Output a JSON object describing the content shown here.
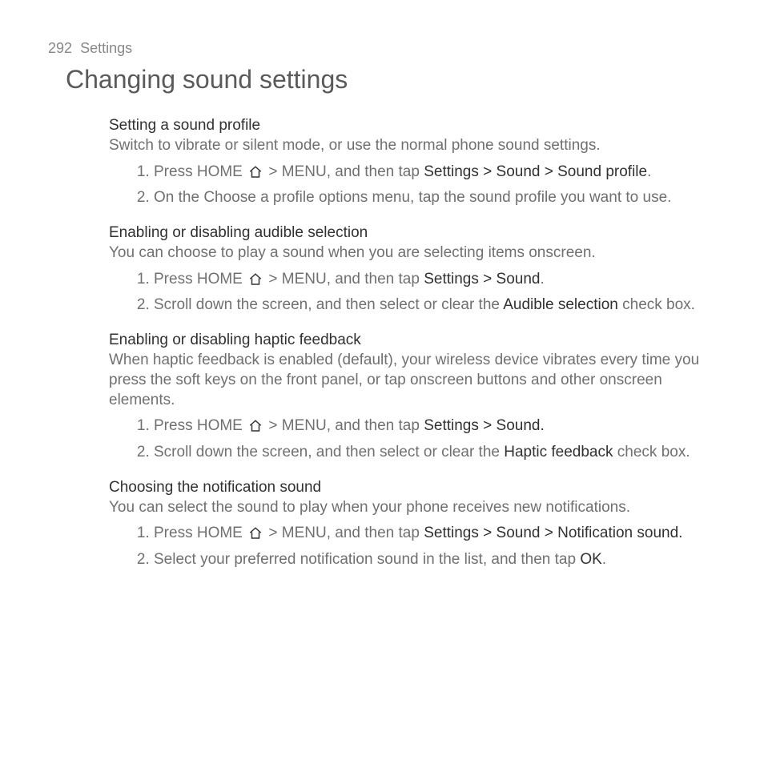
{
  "header": {
    "page_number": "292",
    "section_name": "Settings"
  },
  "title": "Changing sound settings",
  "s1": {
    "heading": "Setting a sound profile",
    "intro": "Switch to vibrate or silent mode, or use the normal phone sound settings.",
    "li1a": "Press HOME ",
    "li1b": " > MENU, and then tap ",
    "li1c": "Settings > Sound > Sound profile",
    "li1d": ".",
    "li2": "On the Choose a profile options menu, tap the sound profile you want to use."
  },
  "s2": {
    "heading": "Enabling or disabling audible selection",
    "intro": "You can choose to play a sound when you are selecting items onscreen.",
    "li1a": "Press HOME ",
    "li1b": " > MENU, and then tap ",
    "li1c": "Settings > Sound",
    "li1d": ".",
    "li2a": "Scroll down the screen, and then select or clear the ",
    "li2b": "Audible selection",
    "li2c": " check box."
  },
  "s3": {
    "heading": "Enabling or disabling haptic feedback",
    "intro": "When haptic feedback is enabled (default), your wireless device vibrates every time you press the soft keys on the front panel, or tap onscreen buttons and other onscreen elements.",
    "li1a": "Press HOME ",
    "li1b": " > MENU, and then tap ",
    "li1c": "Settings > Sound.",
    "li2a": "Scroll down the screen, and then select or clear the ",
    "li2b": "Haptic feedback",
    "li2c": " check box."
  },
  "s4": {
    "heading": "Choosing the notification sound",
    "intro": "You can select the sound to play when your phone receives new notifications.",
    "li1a": "Press HOME ",
    "li1b": " > MENU, and then tap ",
    "li1c": "Settings > Sound > Notification sound.",
    "li2a": "Select your preferred notification sound in the list, and then tap ",
    "li2b": "OK",
    "li2c": "."
  }
}
